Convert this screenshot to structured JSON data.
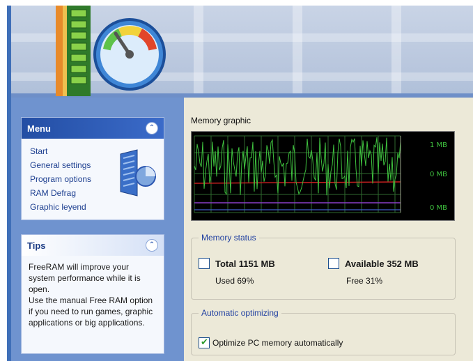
{
  "menu": {
    "title": "Menu",
    "items": [
      {
        "label": "Start"
      },
      {
        "label": "General settings"
      },
      {
        "label": "Program options"
      },
      {
        "label": "RAM Defrag"
      },
      {
        "label": "Graphic leyend"
      }
    ]
  },
  "tips": {
    "title": "Tips",
    "text_1": "FreeRAM will improve your system performance while it is open.",
    "text_2": "Use the manual Free RAM option if you need to run games, graphic applications or big applications."
  },
  "memory_graphic": {
    "label": "Memory graphic",
    "scale_labels": [
      "1 MB",
      "0 MB",
      "0 MB"
    ]
  },
  "memory_status": {
    "legend": "Memory status",
    "total": {
      "label": "Total 1151 MB",
      "checked": false,
      "sub": "Used 69%"
    },
    "available": {
      "label": "Available 352 MB",
      "checked": false,
      "sub": "Free 31%"
    }
  },
  "auto": {
    "legend": "Automatic optimizing",
    "option_label": "Optimize PC memory automatically",
    "checked": true
  },
  "colors": {
    "graph_line": "#3fc23f",
    "graph_red": "#c82020",
    "graph_purple": "#8a3fc8",
    "graph_blue": "#4060d0",
    "accent": "#234ea4",
    "panel": "#6f93cf"
  }
}
